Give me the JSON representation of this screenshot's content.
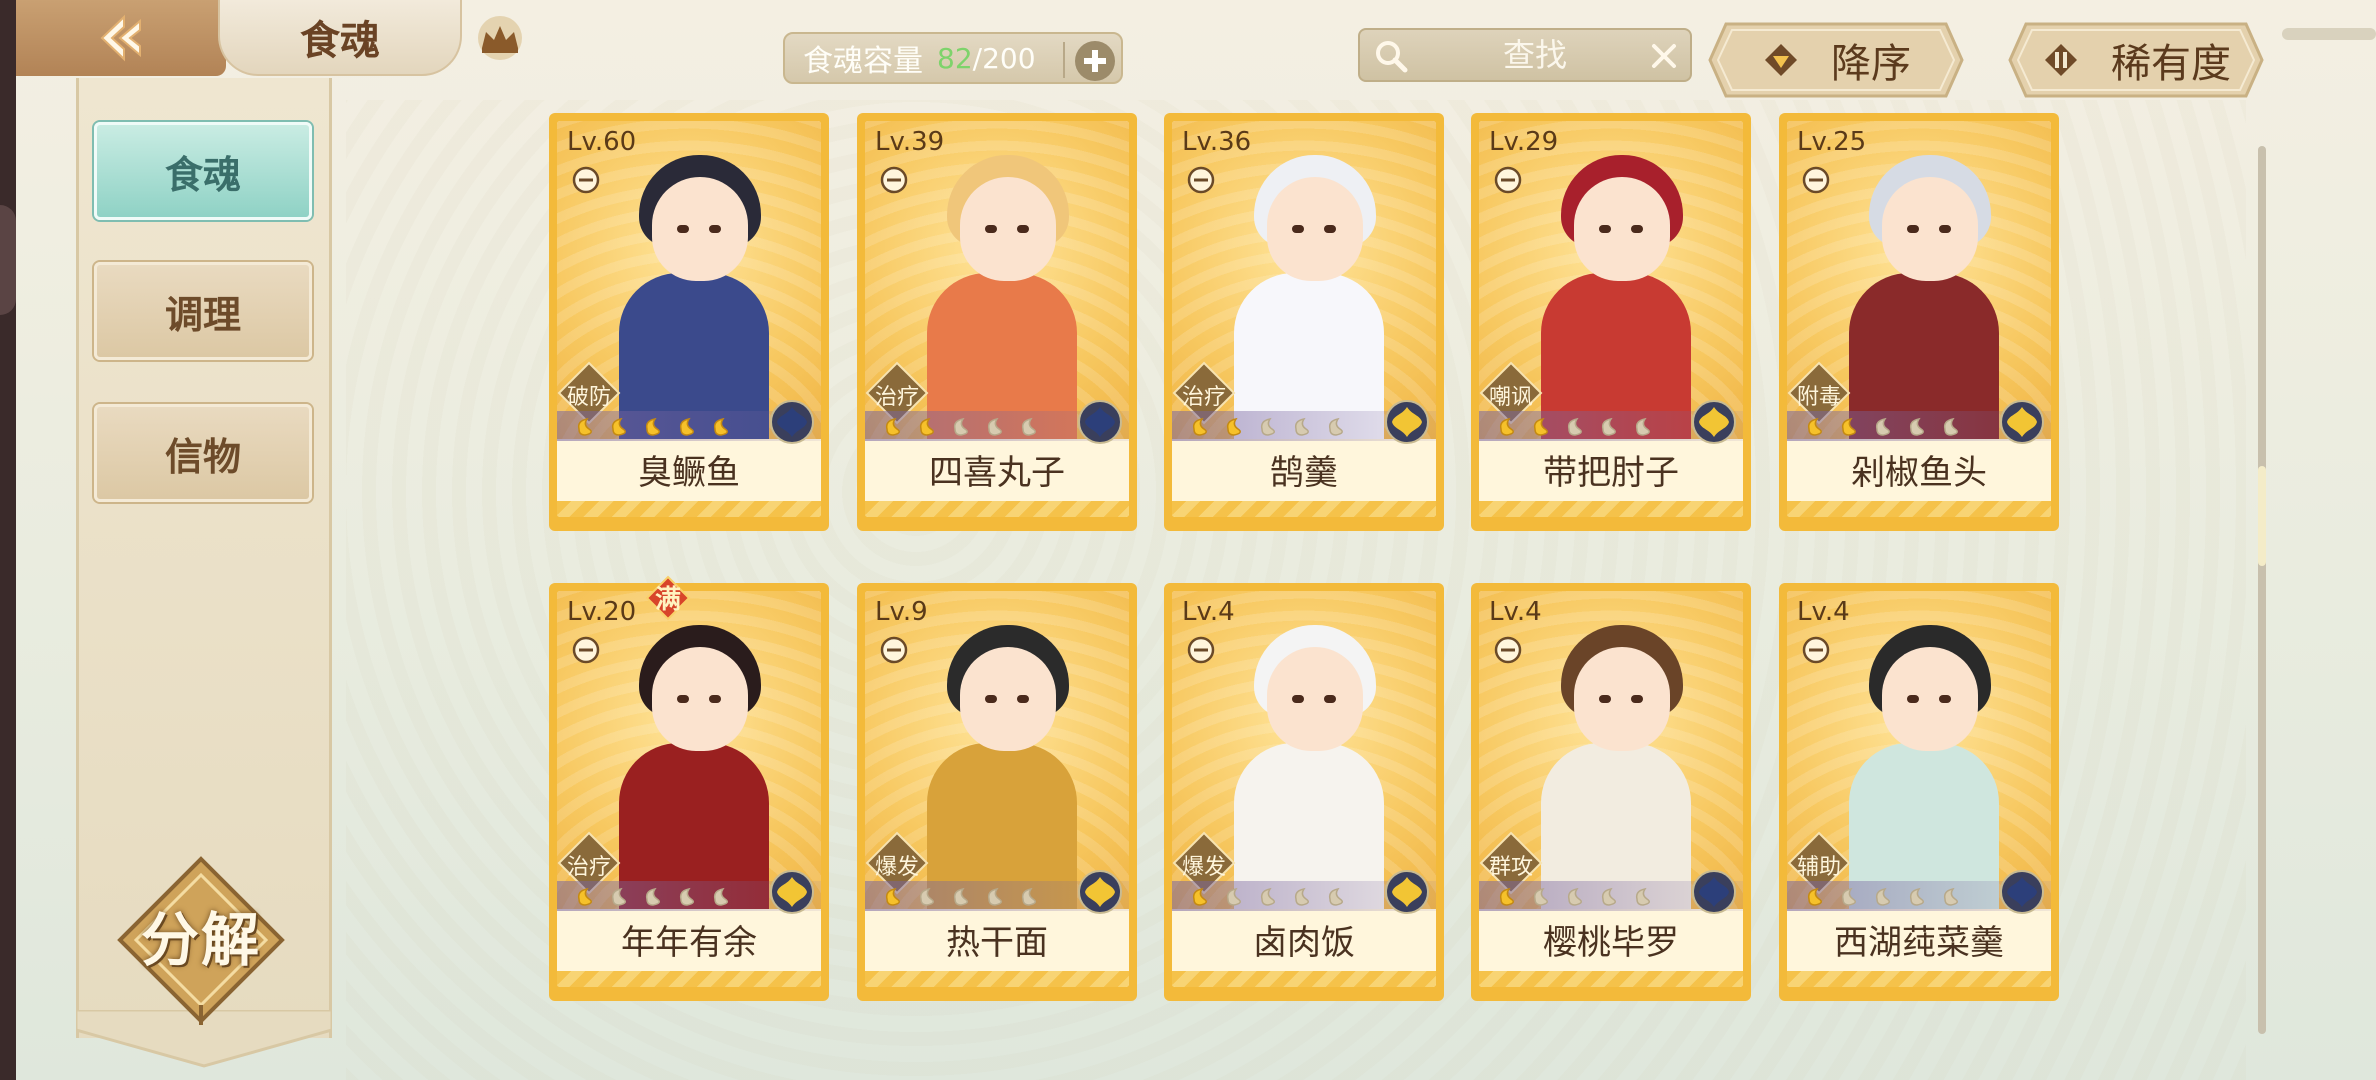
{
  "header": {
    "title": "食魂",
    "back_icon": "back-arrow-icon",
    "crown_icon": "crown-icon"
  },
  "capacity": {
    "label": "食魂容量",
    "current": "82",
    "max": "/200",
    "current_color": "#7ed36b"
  },
  "search": {
    "placeholder": "查找"
  },
  "sort": {
    "order_label": "降序",
    "rarity_label": "稀有度"
  },
  "sidebar": {
    "tabs": [
      {
        "label": "食魂",
        "active": true
      },
      {
        "label": "调理",
        "active": false
      },
      {
        "label": "信物",
        "active": false
      }
    ],
    "decompose_label": "分解"
  },
  "cards": [
    {
      "level": "Lv.60",
      "name": "臭鳜鱼",
      "role": "破防",
      "stars": 5,
      "element": "blue"
    },
    {
      "level": "Lv.39",
      "name": "四喜丸子",
      "role": "治疗",
      "stars": 2,
      "element": "blue"
    },
    {
      "level": "Lv.36",
      "name": "鹄羹",
      "role": "治疗",
      "stars": 2,
      "element": "gold"
    },
    {
      "level": "Lv.29",
      "name": "带把肘子",
      "role": "嘲讽",
      "stars": 2,
      "element": "gold"
    },
    {
      "level": "Lv.25",
      "name": "剁椒鱼头",
      "role": "附毒",
      "stars": 2,
      "element": "gold"
    },
    {
      "level": "Lv.20",
      "name": "年年有余",
      "role": "治疗",
      "stars": 1,
      "element": "gold",
      "badge": "满"
    },
    {
      "level": "Lv.9",
      "name": "热干面",
      "role": "爆发",
      "stars": 1,
      "element": "gold"
    },
    {
      "level": "Lv.4",
      "name": "卤肉饭",
      "role": "爆发",
      "stars": 1,
      "element": "gold"
    },
    {
      "level": "Lv.4",
      "name": "樱桃毕罗",
      "role": "群攻",
      "stars": 1,
      "element": "blue"
    },
    {
      "level": "Lv.4",
      "name": "西湖莼菜羹",
      "role": "辅助",
      "stars": 1,
      "element": "blue"
    }
  ],
  "colors": {
    "card_frame": "#f3ba3a",
    "active_tab": "#8fd2c5",
    "text_brown": "#4a3220"
  }
}
